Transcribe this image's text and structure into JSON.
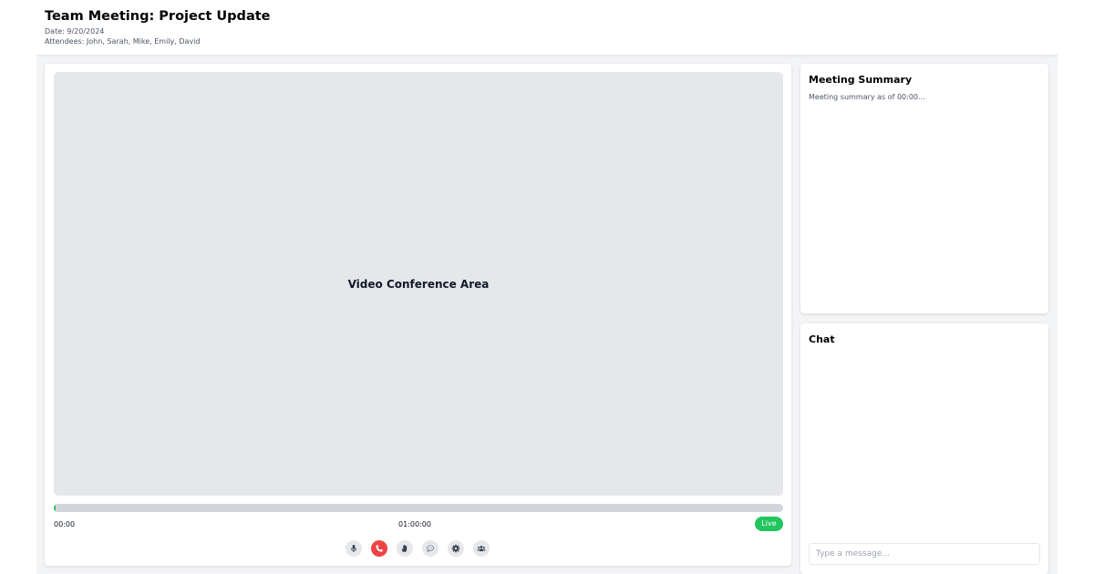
{
  "header": {
    "title": "Team Meeting: Project Update",
    "date": "Date: 9/20/2024",
    "attendees": "Attendees: John, Sarah, Mike, Emily, David"
  },
  "video": {
    "area_label": "Video Conference Area",
    "progress_fraction": 0.002,
    "time_start": "00:00",
    "time_end": "01:00:00",
    "live_label": "Live",
    "colors": {
      "progress": "#22c55e",
      "live": "#22c55e",
      "end_call": "#ef4444"
    }
  },
  "controls": [
    {
      "name": "mic-button",
      "icon": "microphone-icon"
    },
    {
      "name": "end-call-button",
      "icon": "phone-icon"
    },
    {
      "name": "raise-hand-button",
      "icon": "hand-icon"
    },
    {
      "name": "chat-toggle-button",
      "icon": "chat-bubble-icon"
    },
    {
      "name": "settings-button",
      "icon": "gear-icon"
    },
    {
      "name": "participants-button",
      "icon": "users-icon"
    }
  ],
  "summary": {
    "title": "Meeting Summary",
    "text": "Meeting summary as of 00:00..."
  },
  "chat": {
    "title": "Chat",
    "input_placeholder": "Type a message..."
  }
}
